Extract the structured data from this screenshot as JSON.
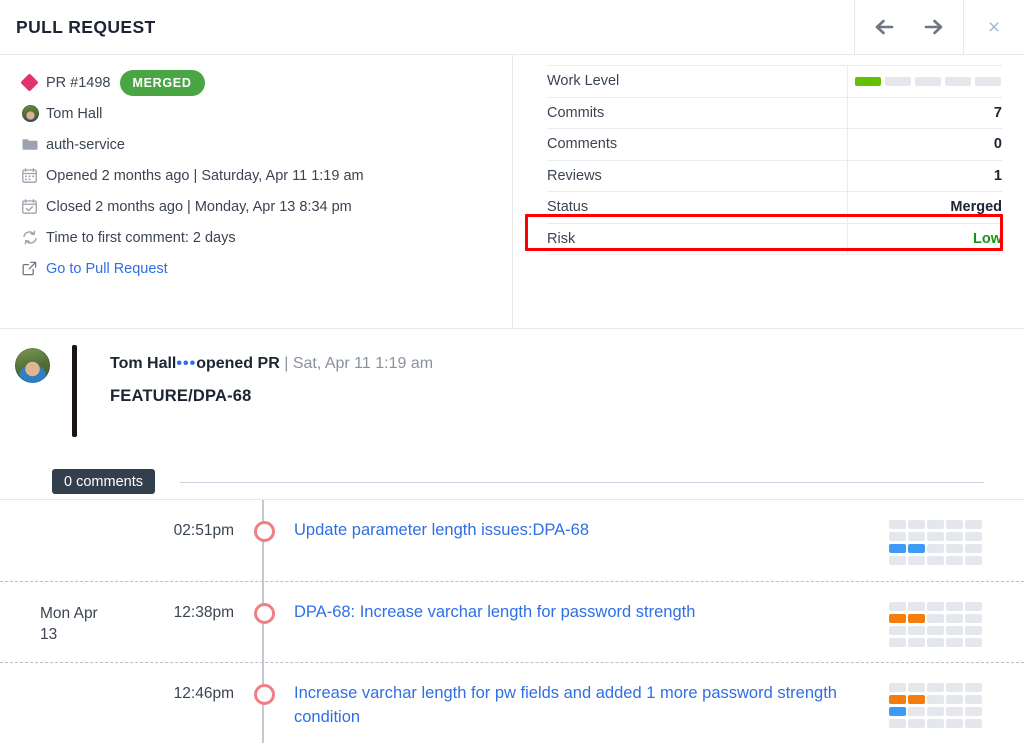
{
  "header": {
    "title": "PULL REQUEST",
    "back_icon": "arrow-left-icon",
    "forward_icon": "arrow-right-icon",
    "close_icon": "close-icon",
    "close_label": "×"
  },
  "pull_request": {
    "id_label": "PR #1498",
    "status_badge": "MERGED",
    "author": "Tom Hall",
    "repository": "auth-service",
    "opened": "Opened 2 months ago | Saturday, Apr 11 1:19 am",
    "closed": "Closed 2 months ago | Monday, Apr 13 8:34 pm",
    "time_to_first_comment": "Time to first comment: 2 days",
    "external_link": "Go to Pull Request"
  },
  "stats": {
    "rows": [
      {
        "label": "Work Level",
        "value": "",
        "type": "worklevel"
      },
      {
        "label": "Commits",
        "value": "7",
        "type": "text"
      },
      {
        "label": "Comments",
        "value": "0",
        "type": "text"
      },
      {
        "label": "Reviews",
        "value": "1",
        "type": "text"
      },
      {
        "label": "Status",
        "value": "Merged",
        "type": "text"
      },
      {
        "label": "Risk",
        "value": "Low",
        "type": "text",
        "color": "green"
      }
    ],
    "work_level_segments": 5,
    "work_level_filled": 1,
    "work_level_color": "#63c104",
    "risk_highlight_color": "#ff0000"
  },
  "activity": {
    "author": "Tom Hall",
    "separator": "•••",
    "action": "opened PR",
    "divider": "|",
    "timestamp": "Sat, Apr 11 1:19 am",
    "branch": "FEATURE/DPA-68"
  },
  "comments": {
    "badge": "0 comments"
  },
  "timeline": {
    "rows": [
      {
        "date": "",
        "time": "02:51pm",
        "title": "Update parameter length issues:DPA-68",
        "grid": [
          [
            "off",
            "off",
            "off",
            "off",
            "off"
          ],
          [
            "off",
            "off",
            "off",
            "off",
            "off"
          ],
          [
            "blue",
            "blue",
            "off",
            "off",
            "off"
          ],
          [
            "off",
            "off",
            "off",
            "off",
            "off"
          ]
        ]
      },
      {
        "date": "Mon Apr 13",
        "time": "12:38pm",
        "title": "DPA-68: Increase varchar length for password strength",
        "grid": [
          [
            "off",
            "off",
            "off",
            "off",
            "off"
          ],
          [
            "orange",
            "orange",
            "off",
            "off",
            "off"
          ],
          [
            "off",
            "off",
            "off",
            "off",
            "off"
          ],
          [
            "off",
            "off",
            "off",
            "off",
            "off"
          ]
        ]
      },
      {
        "date": "",
        "time": "12:46pm",
        "title": "Increase varchar length for pw fields and added 1 more password strength condition",
        "grid": [
          [
            "off",
            "off",
            "off",
            "off",
            "off"
          ],
          [
            "orange",
            "orange",
            "off",
            "off",
            "off"
          ],
          [
            "blue",
            "off",
            "off",
            "off",
            "off"
          ],
          [
            "off",
            "off",
            "off",
            "off",
            "off"
          ]
        ]
      }
    ]
  }
}
